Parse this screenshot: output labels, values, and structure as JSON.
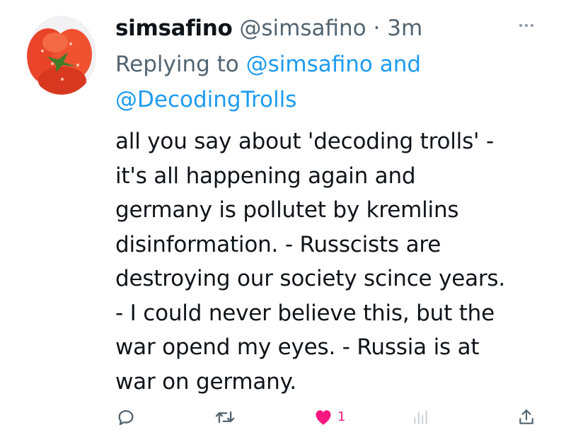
{
  "author": {
    "display_name": "simsafino",
    "handle": "@simsafino",
    "separator": "·",
    "time": "3m"
  },
  "reply": {
    "prefix": "Replying to",
    "mention1": "@simsafino",
    "conjunction": "and",
    "mention2": "@DecodingTrolls"
  },
  "tweet_lines": [
    "all you say about 'decoding trolls' -",
    "it's all happening again and",
    "germany is pollutet by kremlins",
    "disinformation. - Russcists are",
    "destroying our society scince years.",
    "- I could never believe this, but the",
    "war opend my eyes. - Russia is at",
    "war on germany."
  ],
  "actions": {
    "like_count": "1"
  },
  "icons": {
    "reply": "reply-icon",
    "retweet": "retweet-icon",
    "like": "heart-icon",
    "views": "analytics-icon",
    "share": "share-icon",
    "more": "more-icon"
  },
  "colors": {
    "link": "#1d9bf0",
    "muted": "#536471",
    "like": "#f91880",
    "text": "#0f1419"
  }
}
